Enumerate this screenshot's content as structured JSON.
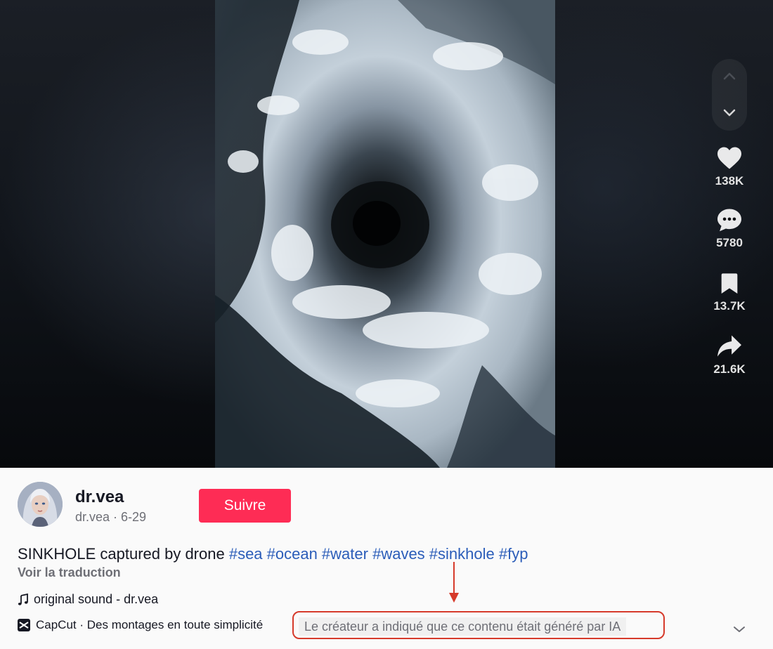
{
  "actions": {
    "likes": "138K",
    "comments": "5780",
    "saves": "13.7K",
    "shares": "21.6K"
  },
  "author": {
    "username": "dr.vea",
    "subline": "dr.vea · 6-29"
  },
  "follow_label": "Suivre",
  "description": {
    "text": "SINKHOLE captured by drone ",
    "hashtags": "#sea #ocean #water #waves #sinkhole #fyp"
  },
  "translate_label": "Voir la traduction",
  "sound_label": "original sound - dr.vea",
  "capcut_label": "CapCut · Des montages en toute simplicité",
  "ai_label": "Le créateur a indiqué que ce contenu était généré par IA",
  "colors": {
    "follow": "#fe2c55",
    "hashtag": "#2b5db9",
    "annotation": "#d63a2b"
  },
  "icons": [
    "chevron-up-icon",
    "chevron-down-icon",
    "heart-icon",
    "comment-icon",
    "bookmark-icon",
    "share-icon",
    "music-note-icon",
    "capcut-icon",
    "expand-chevron-icon"
  ]
}
